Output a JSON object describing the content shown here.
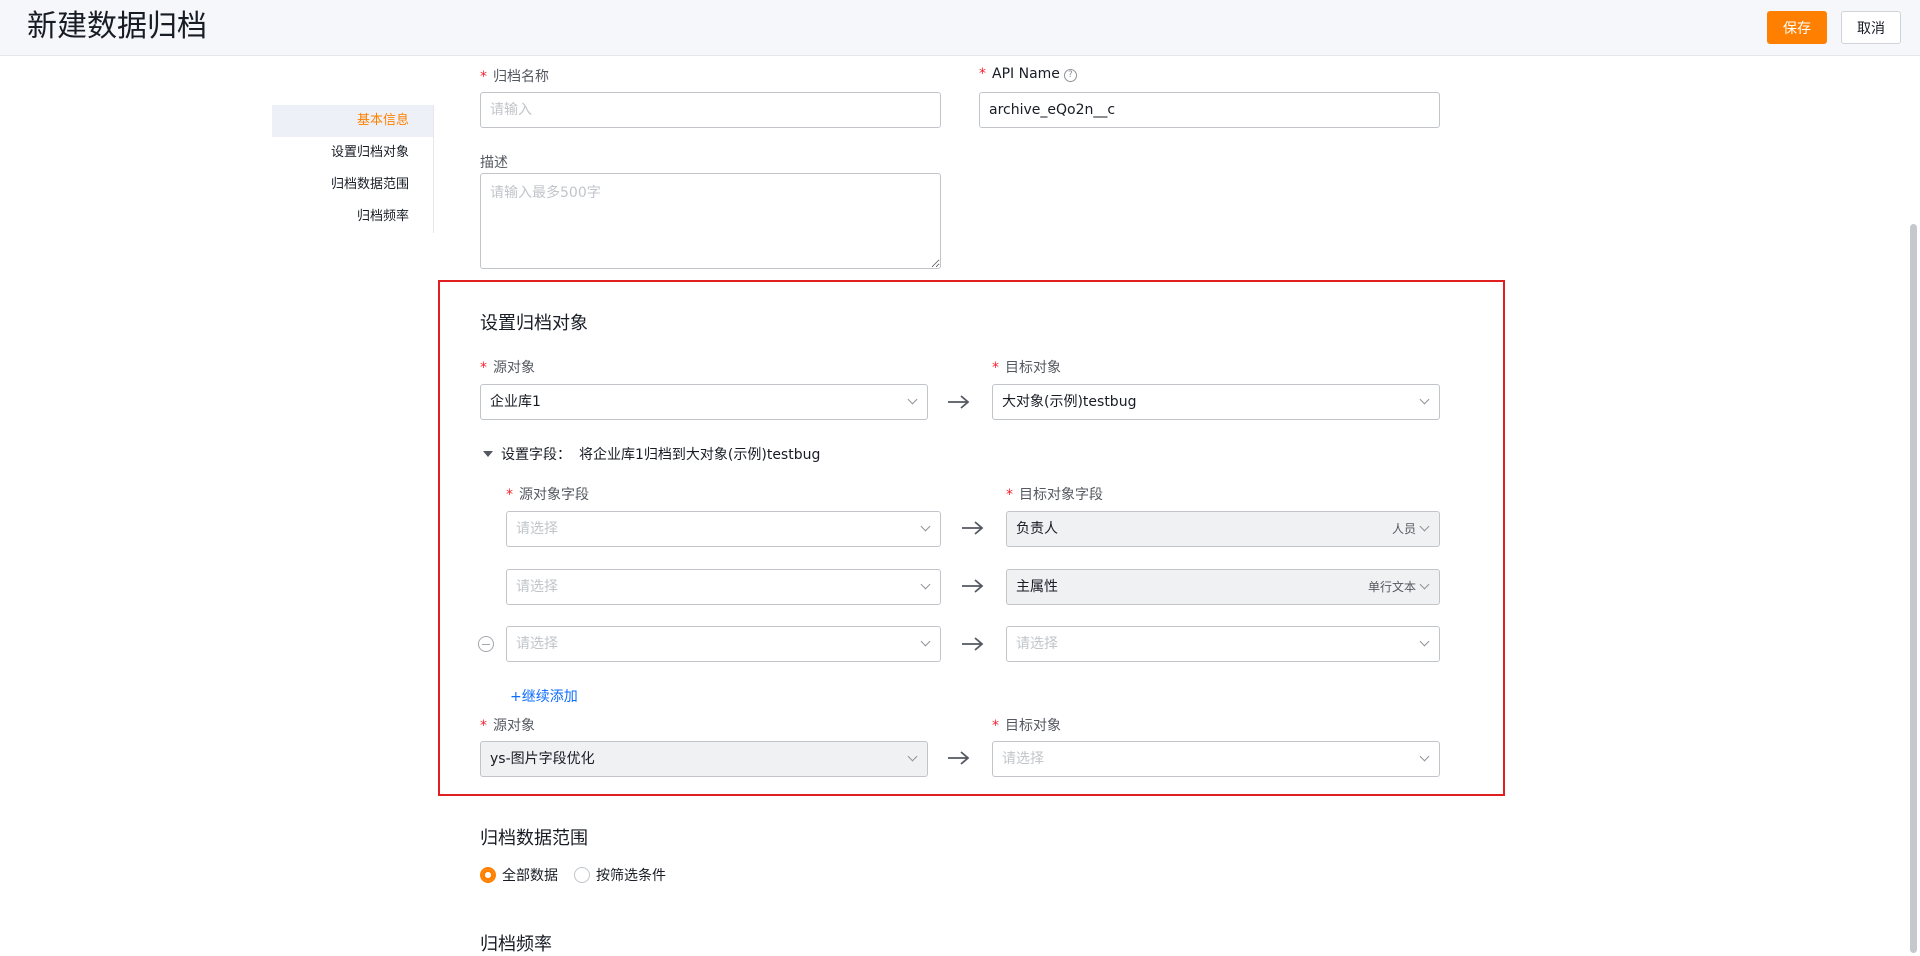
{
  "header": {
    "title": "新建数据归档",
    "save_label": "保存",
    "cancel_label": "取消"
  },
  "sidenav": {
    "items": [
      {
        "label": "基本信息",
        "active": true
      },
      {
        "label": "设置归档对象",
        "active": false
      },
      {
        "label": "归档数据范围",
        "active": false
      },
      {
        "label": "归档频率",
        "active": false
      }
    ]
  },
  "basic": {
    "name_label": "归档名称",
    "name_placeholder": "请输入",
    "api_label": "API Name",
    "api_value": "archive_eQo2n__c",
    "desc_label": "描述",
    "desc_placeholder": "请输入最多500字"
  },
  "archive_object": {
    "title": "设置归档对象",
    "source_label": "源对象",
    "target_label": "目标对象",
    "source_value": "企业库1",
    "target_value": "大对象(示例)testbug",
    "fields_toggle": "设置字段：",
    "fields_desc": "将企业库1归档到大对象(示例)testbug",
    "source_field_label": "源对象字段",
    "target_field_label": "目标对象字段",
    "mappings": [
      {
        "source_placeholder": "请选择",
        "target_value": "负责人",
        "target_type": "人员"
      },
      {
        "source_placeholder": "请选择",
        "target_value": "主属性",
        "target_type": "单行文本"
      },
      {
        "source_placeholder": "请选择",
        "target_placeholder": "请选择"
      }
    ],
    "add_more": "+继续添加",
    "source2_label": "源对象",
    "target2_label": "目标对象",
    "source2_value": "ys-图片字段优化",
    "target2_placeholder": "请选择"
  },
  "range": {
    "title": "归档数据范围",
    "option_all": "全部数据",
    "option_filter": "按筛选条件",
    "selected": "全部数据"
  },
  "frequency": {
    "title": "归档频率"
  },
  "colors": {
    "accent": "#ff8000",
    "link": "#0c6cff",
    "required": "#f5222d",
    "highlight": "#e02020"
  }
}
